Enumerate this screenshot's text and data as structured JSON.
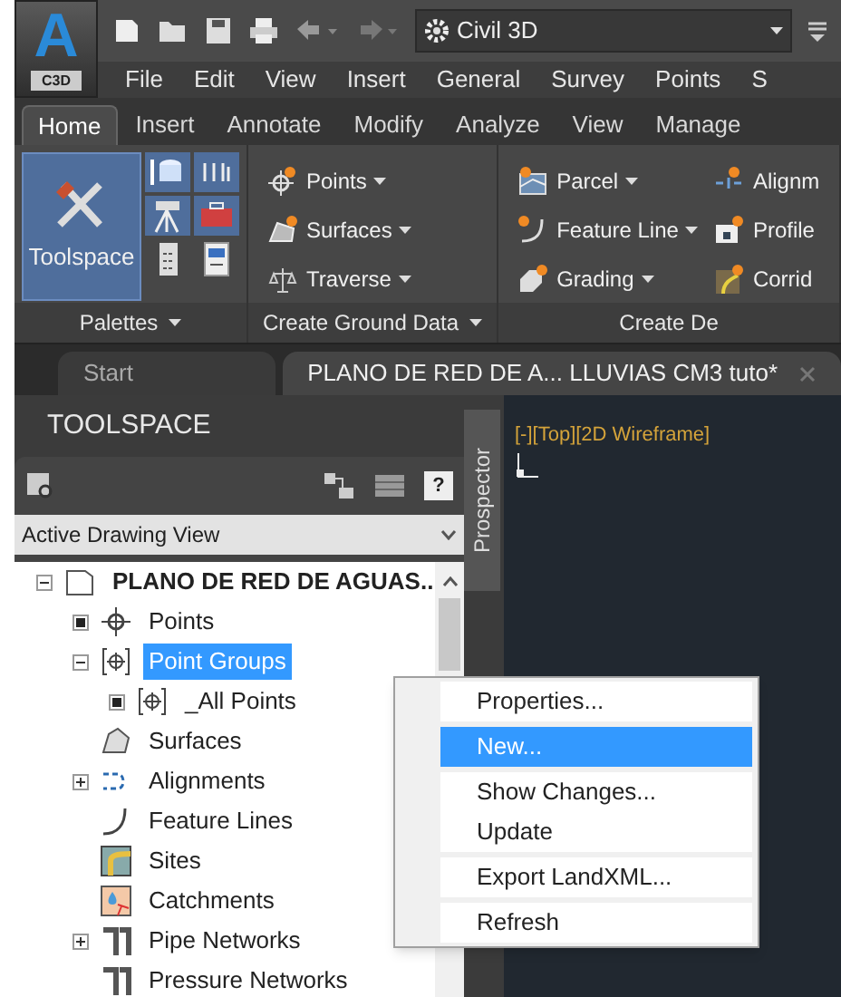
{
  "app_button": {
    "logo": "A",
    "label": "C3D"
  },
  "workspace": {
    "value": "Civil 3D"
  },
  "menu_bar": [
    "File",
    "Edit",
    "View",
    "Insert",
    "General",
    "Survey",
    "Points",
    "S"
  ],
  "ribbon_tabs": [
    {
      "label": "Home",
      "selected": true
    },
    {
      "label": "Insert",
      "selected": false
    },
    {
      "label": "Annotate",
      "selected": false
    },
    {
      "label": "Modify",
      "selected": false
    },
    {
      "label": "Analyze",
      "selected": false
    },
    {
      "label": "View",
      "selected": false
    },
    {
      "label": "Manage",
      "selected": false
    }
  ],
  "ribbon_panels": [
    {
      "kind": "palettes",
      "label": "Palettes",
      "dropdown": true,
      "big_button": {
        "label": "Toolspace",
        "selected": true
      }
    },
    {
      "kind": "commands",
      "label": "Create Ground Data",
      "dropdown": true,
      "columns": [
        [
          {
            "kind": "point",
            "label": "Points",
            "dropdown": true
          },
          {
            "kind": "surface",
            "label": "Surfaces",
            "dropdown": true
          },
          {
            "kind": "traverse",
            "label": "Traverse",
            "dropdown": true
          }
        ]
      ]
    },
    {
      "kind": "commands",
      "label": "Create De",
      "dropdown": false,
      "columns": [
        [
          {
            "kind": "parcel",
            "label": "Parcel",
            "dropdown": true
          },
          {
            "kind": "featureline",
            "label": "Feature Line",
            "dropdown": true
          },
          {
            "kind": "grading",
            "label": "Grading",
            "dropdown": true
          }
        ],
        [
          {
            "kind": "alignment",
            "label": "Alignm",
            "dropdown": false
          },
          {
            "kind": "profile",
            "label": "Profile",
            "dropdown": false
          },
          {
            "kind": "corridor",
            "label": "Corrid",
            "dropdown": false
          }
        ]
      ]
    }
  ],
  "doc_tabs": [
    {
      "label": "Start",
      "selected": false,
      "closable": false
    },
    {
      "label": "PLANO DE RED DE A... LLUVIAS CM3 tuto*",
      "selected": true,
      "closable": true
    }
  ],
  "toolspace": {
    "title": "TOOLSPACE",
    "view": "Active Drawing View",
    "side_tab": "Prospector",
    "help": "?",
    "tree": {
      "label": "PLANO DE RED DE AGUAS...",
      "kind": "drawing",
      "expanded": true,
      "selected": false,
      "children": [
        {
          "label": "Points",
          "kind": "points",
          "marker": true,
          "selected": false
        },
        {
          "label": "Point Groups",
          "kind": "group",
          "expanded": true,
          "selected": true,
          "children": [
            {
              "label": "_All Points",
              "kind": "group",
              "marker": true,
              "selected": false
            }
          ]
        },
        {
          "label": "Surfaces",
          "kind": "surface",
          "selected": false
        },
        {
          "label": "Alignments",
          "kind": "alignment",
          "expanded": false,
          "selected": false
        },
        {
          "label": "Feature Lines",
          "kind": "featureline",
          "selected": false
        },
        {
          "label": "Sites",
          "kind": "site",
          "selected": false
        },
        {
          "label": "Catchments",
          "kind": "catchment",
          "selected": false
        },
        {
          "label": "Pipe Networks",
          "kind": "pipe",
          "expanded": false,
          "selected": false
        },
        {
          "label": "Pressure Networks",
          "kind": "pipe",
          "selected": false
        }
      ]
    }
  },
  "viewport": {
    "label": "[-][Top][2D Wireframe]"
  },
  "context_menu": {
    "sections": [
      [
        {
          "label": "Properties...",
          "selected": false
        }
      ],
      [
        {
          "label": "New...",
          "selected": true
        }
      ],
      [
        {
          "label": "Show Changes...",
          "selected": false
        },
        {
          "label": "Update",
          "selected": false
        }
      ],
      [
        {
          "label": "Export LandXML...",
          "selected": false
        }
      ],
      [
        {
          "label": "Refresh",
          "selected": false
        }
      ]
    ]
  }
}
